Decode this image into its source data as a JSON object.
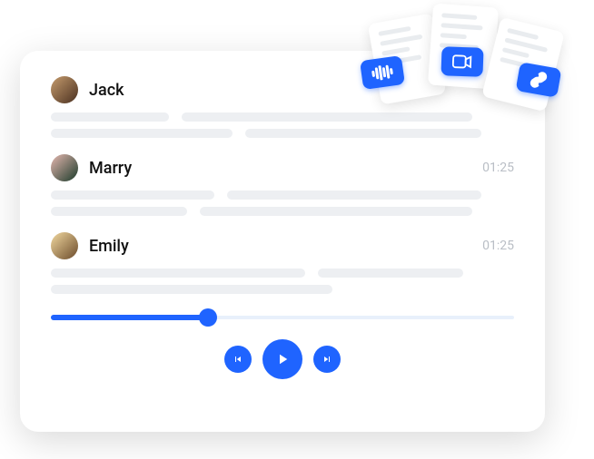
{
  "entries": [
    {
      "name": "Jack",
      "time": ""
    },
    {
      "name": "Marry",
      "time": "01:25"
    },
    {
      "name": "Emily",
      "time": "01:25"
    }
  ],
  "playback": {
    "progress_percent": 34
  },
  "attachments": {
    "badge1": "audio-waveform-icon",
    "badge2": "video-icon",
    "badge3": "link-icon"
  }
}
